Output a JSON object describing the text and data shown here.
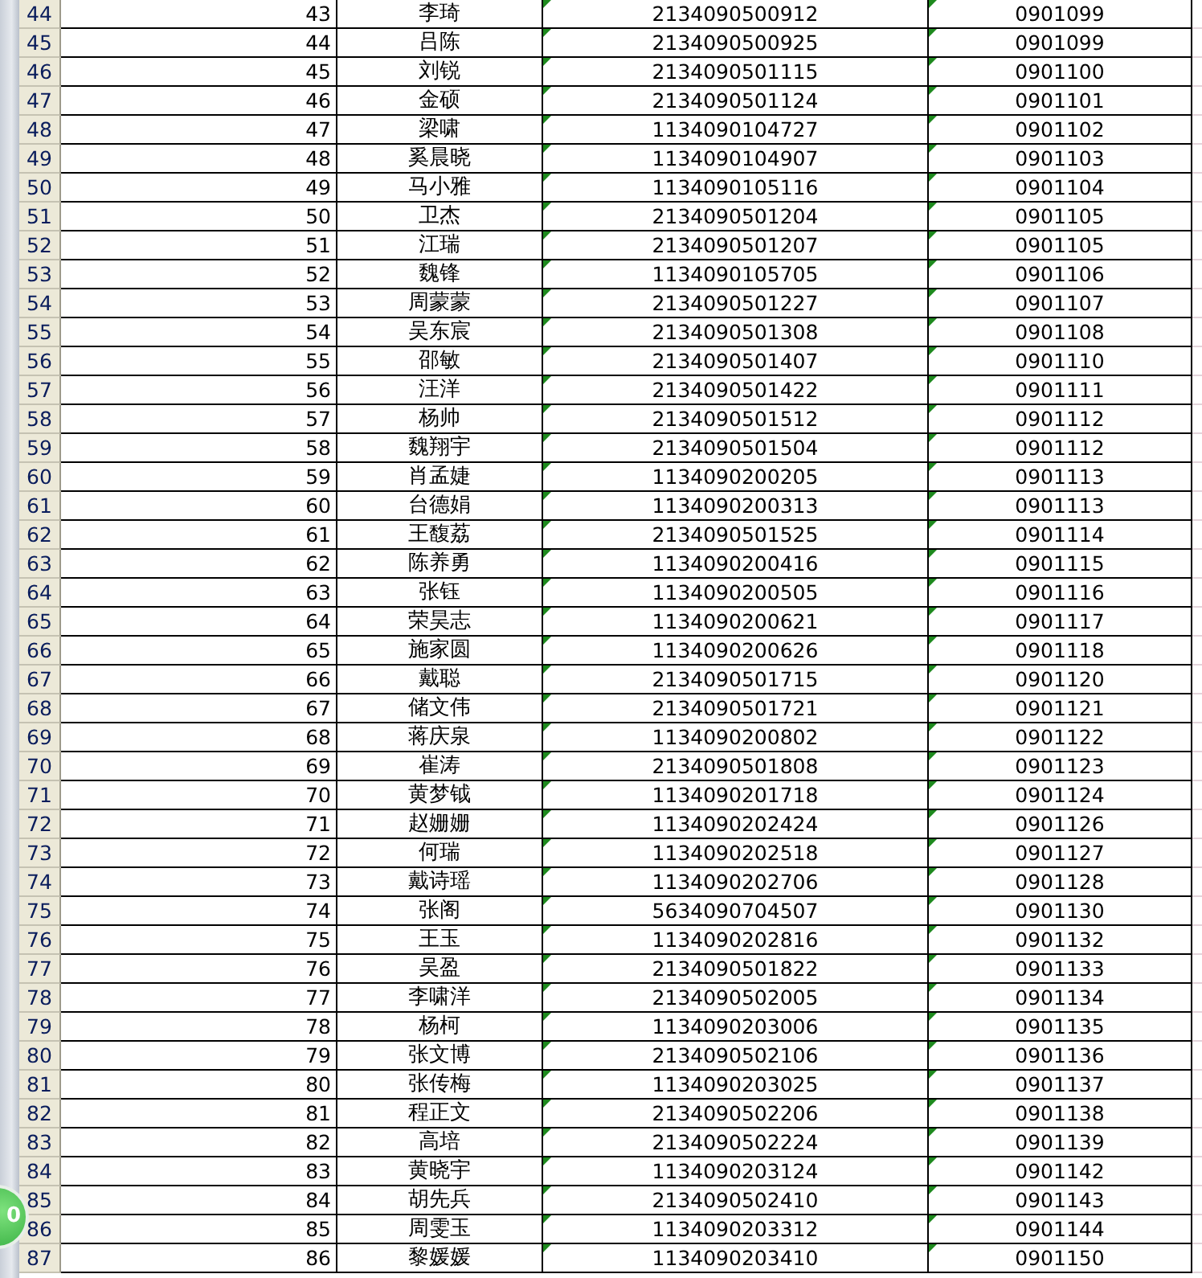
{
  "rows": [
    {
      "row": "44",
      "num": "43",
      "name": "李琦",
      "id": "2134090500912",
      "code": "0901099"
    },
    {
      "row": "45",
      "num": "44",
      "name": "吕陈",
      "id": "2134090500925",
      "code": "0901099"
    },
    {
      "row": "46",
      "num": "45",
      "name": "刘锐",
      "id": "2134090501115",
      "code": "0901100"
    },
    {
      "row": "47",
      "num": "46",
      "name": "金硕",
      "id": "2134090501124",
      "code": "0901101"
    },
    {
      "row": "48",
      "num": "47",
      "name": "梁啸",
      "id": "1134090104727",
      "code": "0901102"
    },
    {
      "row": "49",
      "num": "48",
      "name": "奚晨晓",
      "id": "1134090104907",
      "code": "0901103"
    },
    {
      "row": "50",
      "num": "49",
      "name": "马小雅",
      "id": "1134090105116",
      "code": "0901104"
    },
    {
      "row": "51",
      "num": "50",
      "name": "卫杰",
      "id": "2134090501204",
      "code": "0901105"
    },
    {
      "row": "52",
      "num": "51",
      "name": "江瑞",
      "id": "2134090501207",
      "code": "0901105"
    },
    {
      "row": "53",
      "num": "52",
      "name": "魏锋",
      "id": "1134090105705",
      "code": "0901106"
    },
    {
      "row": "54",
      "num": "53",
      "name": "周蒙蒙",
      "id": "2134090501227",
      "code": "0901107"
    },
    {
      "row": "55",
      "num": "54",
      "name": "吴东宸",
      "id": "2134090501308",
      "code": "0901108"
    },
    {
      "row": "56",
      "num": "55",
      "name": "邵敏",
      "id": "2134090501407",
      "code": "0901110"
    },
    {
      "row": "57",
      "num": "56",
      "name": "汪洋",
      "id": "2134090501422",
      "code": "0901111"
    },
    {
      "row": "58",
      "num": "57",
      "name": "杨帅",
      "id": "2134090501512",
      "code": "0901112"
    },
    {
      "row": "59",
      "num": "58",
      "name": "魏翔宇",
      "id": "2134090501504",
      "code": "0901112"
    },
    {
      "row": "60",
      "num": "59",
      "name": "肖孟婕",
      "id": "1134090200205",
      "code": "0901113"
    },
    {
      "row": "61",
      "num": "60",
      "name": "台德娟",
      "id": "1134090200313",
      "code": "0901113"
    },
    {
      "row": "62",
      "num": "61",
      "name": "王馥荔",
      "id": "2134090501525",
      "code": "0901114"
    },
    {
      "row": "63",
      "num": "62",
      "name": "陈养勇",
      "id": "1134090200416",
      "code": "0901115"
    },
    {
      "row": "64",
      "num": "63",
      "name": "张钰",
      "id": "1134090200505",
      "code": "0901116"
    },
    {
      "row": "65",
      "num": "64",
      "name": "荣昊志",
      "id": "1134090200621",
      "code": "0901117"
    },
    {
      "row": "66",
      "num": "65",
      "name": "施家圆",
      "id": "1134090200626",
      "code": "0901118"
    },
    {
      "row": "67",
      "num": "66",
      "name": "戴聪",
      "id": "2134090501715",
      "code": "0901120"
    },
    {
      "row": "68",
      "num": "67",
      "name": "储文伟",
      "id": "2134090501721",
      "code": "0901121"
    },
    {
      "row": "69",
      "num": "68",
      "name": "蒋庆泉",
      "id": "1134090200802",
      "code": "0901122"
    },
    {
      "row": "70",
      "num": "69",
      "name": "崔涛",
      "id": "2134090501808",
      "code": "0901123"
    },
    {
      "row": "71",
      "num": "70",
      "name": "黄梦钺",
      "id": "1134090201718",
      "code": "0901124"
    },
    {
      "row": "72",
      "num": "71",
      "name": "赵姗姗",
      "id": "1134090202424",
      "code": "0901126"
    },
    {
      "row": "73",
      "num": "72",
      "name": "何瑞",
      "id": "1134090202518",
      "code": "0901127"
    },
    {
      "row": "74",
      "num": "73",
      "name": "戴诗瑶",
      "id": "1134090202706",
      "code": "0901128"
    },
    {
      "row": "75",
      "num": "74",
      "name": "张阁",
      "id": "5634090704507",
      "code": "0901130"
    },
    {
      "row": "76",
      "num": "75",
      "name": "王玉",
      "id": "1134090202816",
      "code": "0901132"
    },
    {
      "row": "77",
      "num": "76",
      "name": "吴盈",
      "id": "2134090501822",
      "code": "0901133"
    },
    {
      "row": "78",
      "num": "77",
      "name": "李啸洋",
      "id": "2134090502005",
      "code": "0901134"
    },
    {
      "row": "79",
      "num": "78",
      "name": "杨柯",
      "id": "1134090203006",
      "code": "0901135"
    },
    {
      "row": "80",
      "num": "79",
      "name": "张文博",
      "id": "2134090502106",
      "code": "0901136"
    },
    {
      "row": "81",
      "num": "80",
      "name": "张传梅",
      "id": "1134090203025",
      "code": "0901137"
    },
    {
      "row": "82",
      "num": "81",
      "name": "程正文",
      "id": "2134090502206",
      "code": "0901138"
    },
    {
      "row": "83",
      "num": "82",
      "name": "高培",
      "id": "2134090502224",
      "code": "0901139"
    },
    {
      "row": "84",
      "num": "83",
      "name": "黄晓宇",
      "id": "1134090203124",
      "code": "0901142"
    },
    {
      "row": "85",
      "num": "84",
      "name": "胡先兵",
      "id": "2134090502410",
      "code": "0901143"
    },
    {
      "row": "86",
      "num": "85",
      "name": "周雯玉",
      "id": "1134090203312",
      "code": "0901144"
    },
    {
      "row": "87",
      "num": "86",
      "name": "黎媛媛",
      "id": "1134090203410",
      "code": "0901150"
    }
  ],
  "floating_badge": {
    "text": "0"
  }
}
